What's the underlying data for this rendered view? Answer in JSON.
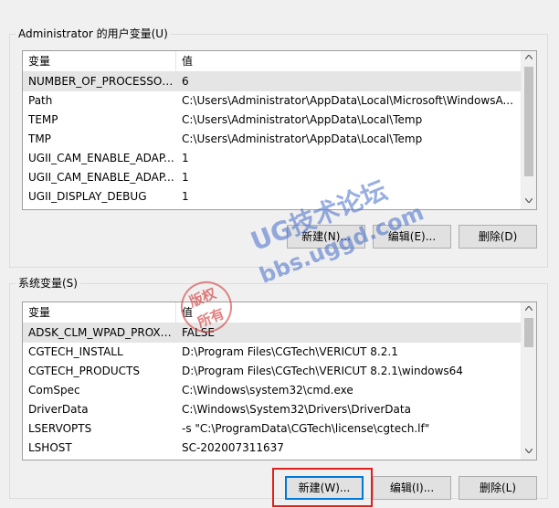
{
  "user_section": {
    "title": "Administrator 的用户变量(U)",
    "columns": [
      "变量",
      "值"
    ],
    "rows": [
      {
        "name": "NUMBER_OF_PROCESSORS",
        "value": "6"
      },
      {
        "name": "Path",
        "value": "C:\\Users\\Administrator\\AppData\\Local\\Microsoft\\WindowsA..."
      },
      {
        "name": "TEMP",
        "value": "C:\\Users\\Administrator\\AppData\\Local\\Temp"
      },
      {
        "name": "TMP",
        "value": "C:\\Users\\Administrator\\AppData\\Local\\Temp"
      },
      {
        "name": "UGII_CAM_ENABLE_ADAP...",
        "value": "1"
      },
      {
        "name": "UGII_CAM_ENABLE_ADAP...",
        "value": "1"
      },
      {
        "name": "UGII_DISPLAY_DEBUG",
        "value": "1"
      }
    ],
    "selected_row": 0,
    "buttons": {
      "new": "新建(N)...",
      "edit": "编辑(E)...",
      "delete": "删除(D)"
    }
  },
  "system_section": {
    "title": "系统变量(S)",
    "columns": [
      "变量",
      "值"
    ],
    "rows": [
      {
        "name": "ADSK_CLM_WPAD_PROXY...",
        "value": "FALSE"
      },
      {
        "name": "CGTECH_INSTALL",
        "value": "D:\\Program Files\\CGTech\\VERICUT 8.2.1"
      },
      {
        "name": "CGTECH_PRODUCTS",
        "value": "D:\\Program Files\\CGTech\\VERICUT 8.2.1\\windows64"
      },
      {
        "name": "ComSpec",
        "value": "C:\\Windows\\system32\\cmd.exe"
      },
      {
        "name": "DriverData",
        "value": "C:\\Windows\\System32\\Drivers\\DriverData"
      },
      {
        "name": "LSERVOPTS",
        "value": "-s \"C:\\ProgramData\\CGTech\\license\\cgtech.lf\""
      },
      {
        "name": "LSHOST",
        "value": "SC-202007311637"
      }
    ],
    "selected_row": 0,
    "buttons": {
      "new": "新建(W)...",
      "edit": "编辑(I)...",
      "delete": "删除(L)"
    }
  },
  "watermark": {
    "main": "UG技术论坛",
    "sub": "bbs.uggd.com",
    "seal": [
      "版权",
      "所有"
    ]
  },
  "colors": {
    "highlight": "#e0201b",
    "default_button_border": "#0078d7"
  }
}
